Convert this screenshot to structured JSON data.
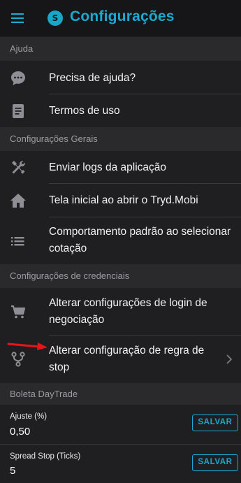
{
  "header": {
    "title": "Configurações",
    "logo_letter": "S",
    "menu_icon": "hamburger-menu-icon"
  },
  "sections": [
    {
      "title": "Ajuda",
      "items": [
        {
          "label": "Precisa de ajuda?",
          "icon": "chat-bubble-icon"
        },
        {
          "label": "Termos de uso",
          "icon": "document-icon"
        }
      ]
    },
    {
      "title": "Configurações Gerais",
      "items": [
        {
          "label": "Enviar logs da aplicação",
          "icon": "wrench-tools-icon"
        },
        {
          "label": "Tela inicial ao abrir o Tryd.Mobi",
          "icon": "home-icon"
        },
        {
          "label": "Comportamento padrão ao selecionar cotação",
          "icon": "list-icon"
        }
      ]
    },
    {
      "title": "Configurações de credenciais",
      "items": [
        {
          "label": "Alterar configurações de login de negociação",
          "icon": "cart-icon"
        },
        {
          "label": "Alterar configuração de regra de stop",
          "icon": "fork-icon",
          "chevron": "chevron-right-icon"
        }
      ]
    }
  ],
  "daytrade": {
    "title": "Boleta DayTrade",
    "fields": [
      {
        "label": "Ajuste (%)",
        "value": "0,50",
        "button": "SALVAR"
      },
      {
        "label": "Spread Stop (Ticks)",
        "value": "5",
        "button": "SALVAR"
      }
    ]
  },
  "colors": {
    "accent": "#1aa9cf",
    "background": "#1f1f22",
    "section_bg": "#2a2a2d",
    "header_bg": "#161618",
    "annotation_arrow": "#e8141c"
  }
}
